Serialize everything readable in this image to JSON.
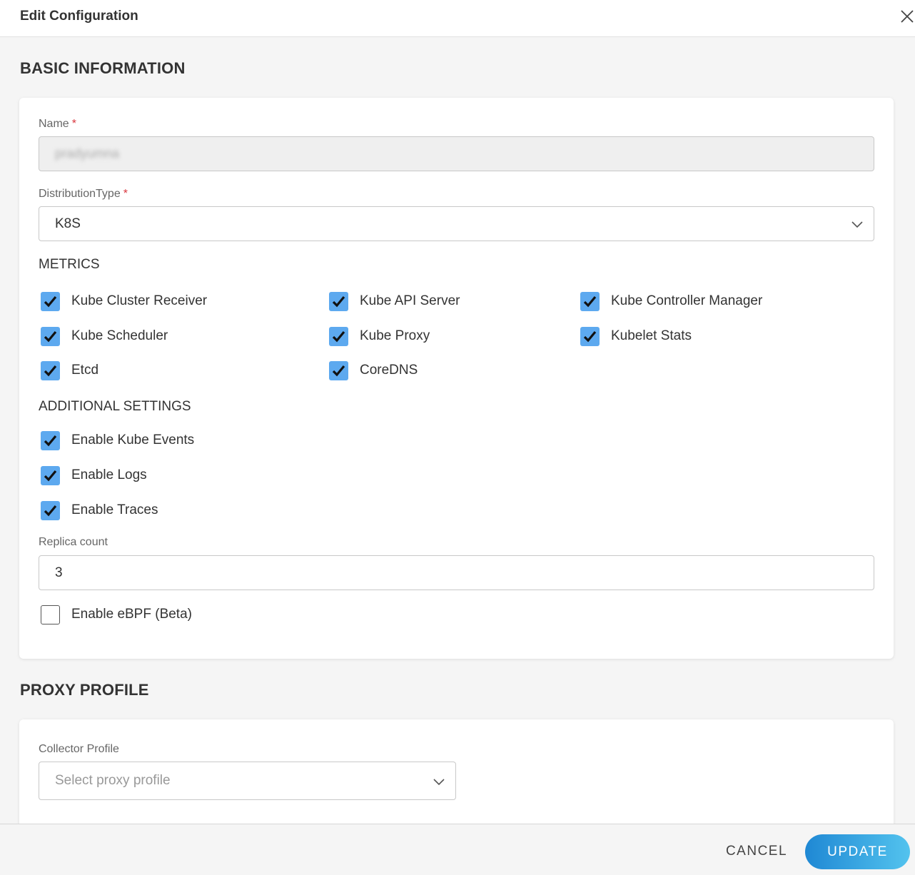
{
  "dialog": {
    "title": "Edit Configuration"
  },
  "basic_info": {
    "heading": "BASIC INFORMATION",
    "name": {
      "label": "Name",
      "required_mark": "*",
      "value": "pradyumna"
    },
    "distribution_type": {
      "label": "DistributionType",
      "required_mark": "*",
      "selected": "K8S"
    },
    "metrics": {
      "title": "METRICS",
      "items": [
        {
          "label": "Kube Cluster Receiver",
          "checked": true
        },
        {
          "label": "Kube API Server",
          "checked": true
        },
        {
          "label": "Kube Controller Manager",
          "checked": true
        },
        {
          "label": "Kube Scheduler",
          "checked": true
        },
        {
          "label": "Kube Proxy",
          "checked": true
        },
        {
          "label": "Kubelet Stats",
          "checked": true
        },
        {
          "label": "Etcd",
          "checked": true
        },
        {
          "label": "CoreDNS",
          "checked": true
        }
      ]
    },
    "additional_settings": {
      "title": "ADDITIONAL SETTINGS",
      "items": [
        {
          "label": "Enable Kube Events",
          "checked": true
        },
        {
          "label": "Enable Logs",
          "checked": true
        },
        {
          "label": "Enable Traces",
          "checked": true
        }
      ]
    },
    "replica_count": {
      "label": "Replica count",
      "value": "3"
    },
    "ebpf": {
      "label": "Enable eBPF (Beta)",
      "checked": false
    }
  },
  "proxy_profile": {
    "heading": "PROXY PROFILE",
    "collector_profile": {
      "label": "Collector Profile",
      "placeholder": "Select proxy profile"
    }
  },
  "footer": {
    "cancel_label": "CANCEL",
    "update_label": "UPDATE"
  },
  "colors": {
    "checkbox": "#5da9ef",
    "primary_start": "#1f88d4",
    "primary_end": "#53c3ee",
    "required": "#d9363e"
  }
}
